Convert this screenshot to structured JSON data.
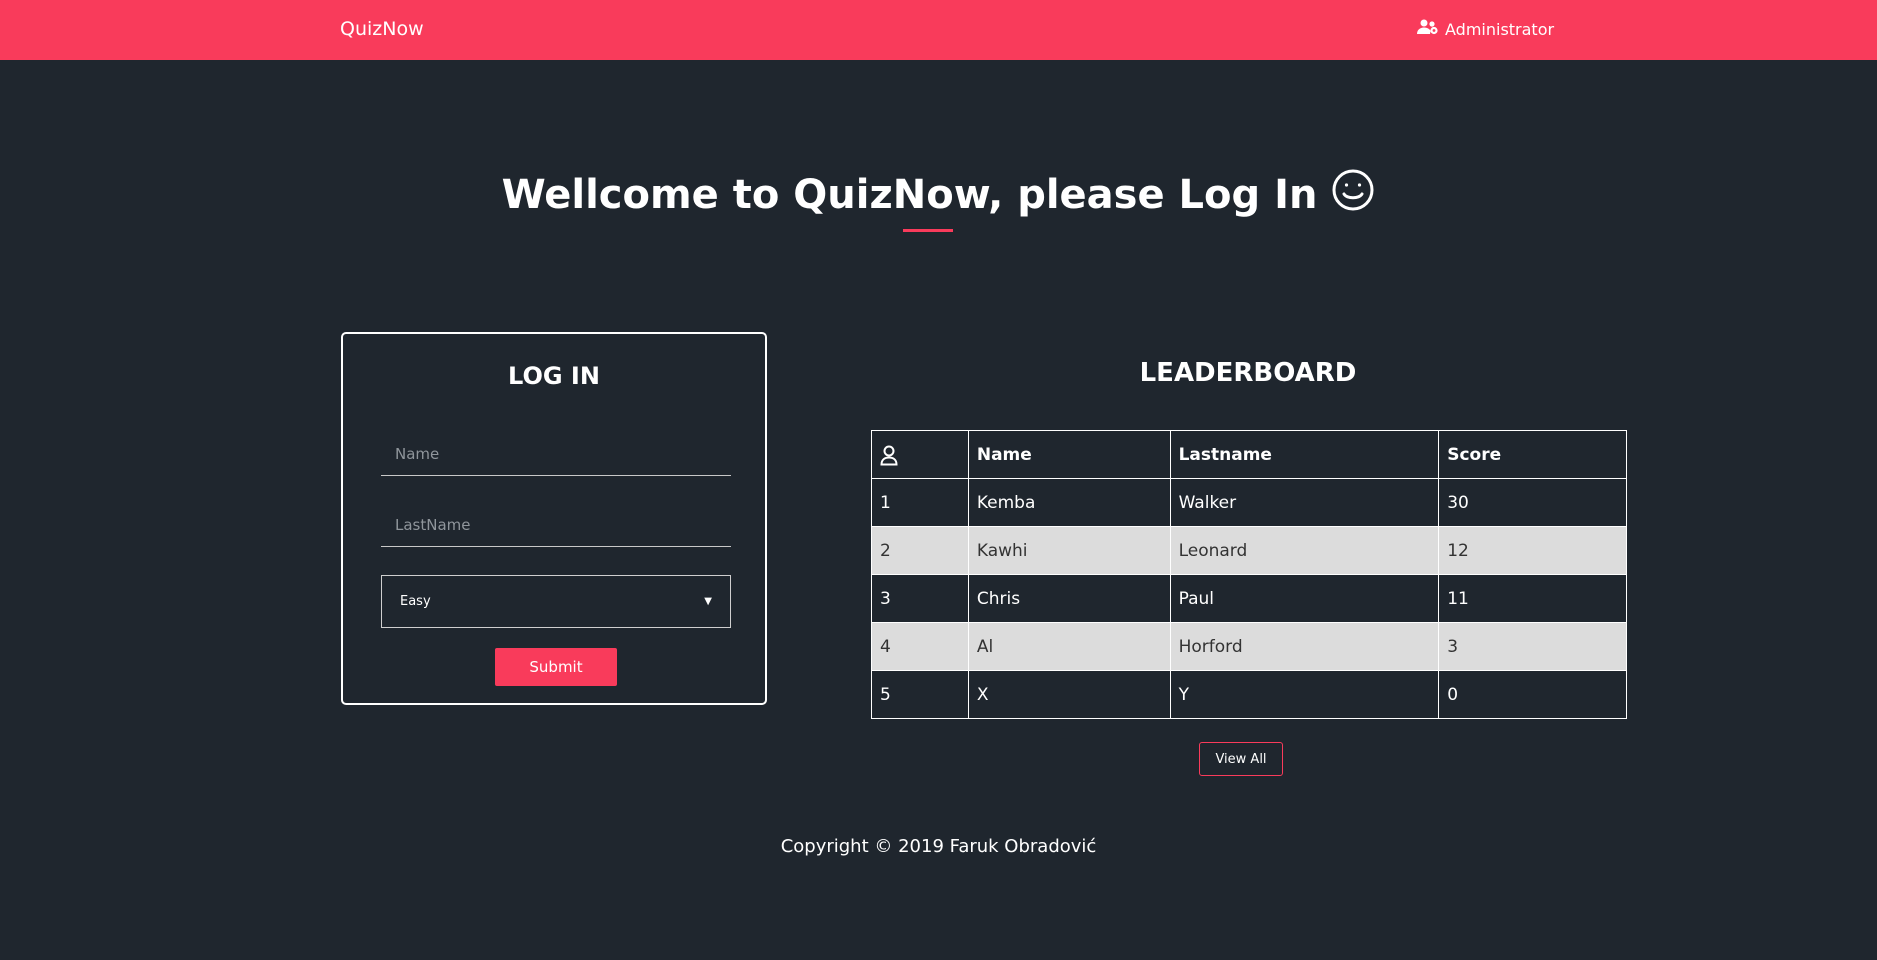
{
  "nav": {
    "brand": "QuizNow",
    "admin_label": "Administrator"
  },
  "hero": {
    "title": "Wellcome to QuizNow, please Log In"
  },
  "login": {
    "title": "LOG IN",
    "name_placeholder": "Name",
    "lastname_placeholder": "LastName",
    "difficulty_selected": "Easy",
    "submit_label": "Submit"
  },
  "leaderboard": {
    "title": "LEADERBOARD",
    "columns": [
      "Name",
      "Lastname",
      "Score"
    ],
    "rows": [
      {
        "rank": "1",
        "name": "Kemba",
        "lastname": "Walker",
        "score": "30"
      },
      {
        "rank": "2",
        "name": "Kawhi",
        "lastname": "Leonard",
        "score": "12"
      },
      {
        "rank": "3",
        "name": "Chris",
        "lastname": "Paul",
        "score": "11"
      },
      {
        "rank": "4",
        "name": "Al",
        "lastname": "Horford",
        "score": "3"
      },
      {
        "rank": "5",
        "name": "X",
        "lastname": "Y",
        "score": "0"
      }
    ],
    "view_all_label": "View All"
  },
  "footer": {
    "copyright": "Copyright © 2019 Faruk Obradović"
  },
  "colors": {
    "accent": "#f93b5b",
    "background": "#1f262e",
    "row_alt": "#dcdcdc"
  }
}
